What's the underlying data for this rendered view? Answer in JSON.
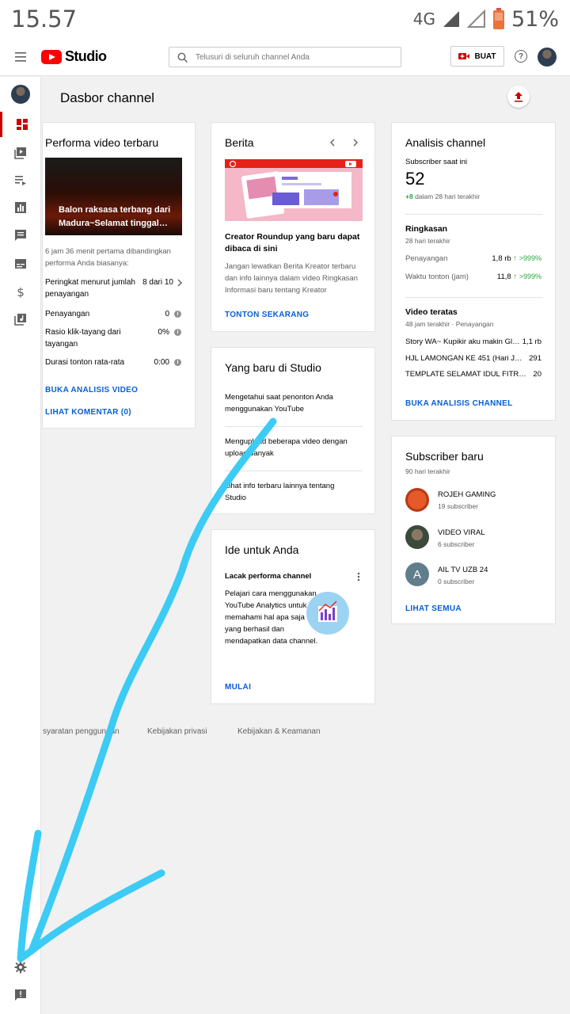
{
  "status_bar": {
    "time": "15.57",
    "network": "4G",
    "battery": "51%"
  },
  "header": {
    "logo_text": "Studio",
    "search_placeholder": "Telusuri di seluruh channel Anda",
    "create_label": "BUAT"
  },
  "page_title": "Dasbor channel",
  "latest_video": {
    "title": "Performa video terbaru",
    "thumbnail_caption": "Balon raksasa terbang dari Madura~Selamat tinggal…",
    "comparison": "6 jam 36 menit pertama dibandingkan performa Anda biasanya:",
    "rank_label": "Peringkat menurut jumlah penayangan",
    "rank_value": "8 dari 10",
    "views_label": "Penayangan",
    "views_value": "0",
    "ctr_label": "Rasio klik-tayang dari tayangan",
    "ctr_value": "0%",
    "avg_duration_label": "Durasi tonton rata-rata",
    "avg_duration_value": "0:00",
    "analytics_link": "BUKA ANALISIS VIDEO",
    "comments_link": "LIHAT KOMENTAR (0)"
  },
  "news": {
    "title": "Berita",
    "headline": "Creator Roundup yang baru dapat dibaca di sini",
    "body": "Jangan lewatkan Berita Kreator terbaru dan info lainnya dalam video Ringkasan Informasi baru tentang Kreator",
    "cta": "TONTON SEKARANG"
  },
  "whats_new": {
    "title": "Yang baru di Studio",
    "items": [
      "Mengetahui saat penonton Anda menggunakan YouTube",
      "Mengupload beberapa video dengan upload banyak",
      "Lihat info terbaru lainnya tentang Studio"
    ]
  },
  "ideas": {
    "title": "Ide untuk Anda",
    "subtitle": "Lacak performa channel",
    "body": "Pelajari cara menggunakan YouTube Analytics untuk memahami hal apa saja yang berhasil dan mendapatkan data channel.",
    "cta": "MULAI"
  },
  "channel_analytics": {
    "title": "Analisis channel",
    "current_subs_label": "Subscriber saat ini",
    "current_subs": "52",
    "delta": "+8",
    "delta_period": "dalam 28 hari terakhir",
    "summary_title": "Ringkasan",
    "summary_period": "28 hari terakhir",
    "views_label": "Penayangan",
    "views_value": "1,8 rb",
    "views_change": ">999%",
    "watch_label": "Waktu tonton (jam)",
    "watch_value": "11,8",
    "watch_change": ">999%",
    "top_videos_title": "Video teratas",
    "top_videos_period": "48 jam terakhir · Penayangan",
    "top_videos": [
      {
        "title": "Story WA~ Kupikir aku makin Gl…",
        "views": "1,1 rb"
      },
      {
        "title": "HJL LAMONGAN KE 451 (Hari J…",
        "views": "291"
      },
      {
        "title": "TEMPLATE SELAMAT IDUL FITR…",
        "views": "20"
      }
    ],
    "cta": "BUKA ANALISIS CHANNEL"
  },
  "new_subscribers": {
    "title": "Subscriber baru",
    "period": "90 hari terakhir",
    "items": [
      {
        "name": "ROJEH GAMING",
        "subs": "19 subscriber"
      },
      {
        "name": "VIDEO VIRAL",
        "subs": "6 subscriber"
      },
      {
        "name": "AIL TV UZB 24",
        "subs": "0 subscriber",
        "initial": "A"
      }
    ],
    "cta": "LIHAT SEMUA"
  },
  "footer": {
    "terms": "syaratan penggunaan",
    "privacy": "Kebijakan privasi",
    "policy": "Kebijakan & Keamanan"
  },
  "colors": {
    "brand_red": "#ff0000",
    "link_blue": "#065fd4",
    "positive_green": "#2ba640",
    "annotation": "#3ccbf4"
  }
}
